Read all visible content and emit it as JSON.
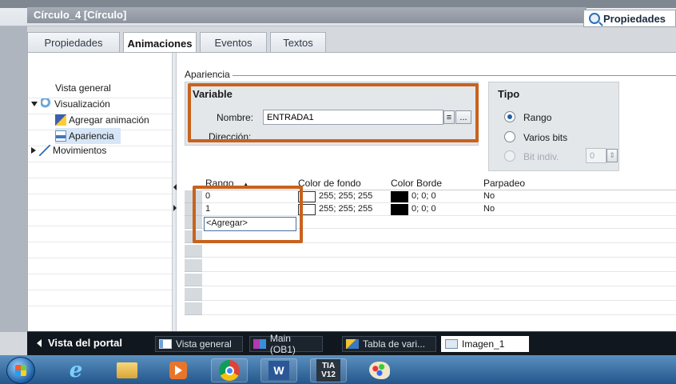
{
  "window": {
    "object_title": "Círculo_4 [Círculo]",
    "properties_button": "Propiedades"
  },
  "tabs": [
    {
      "label": "Propiedades",
      "active": false
    },
    {
      "label": "Animaciones",
      "active": true
    },
    {
      "label": "Eventos",
      "active": false
    },
    {
      "label": "Textos",
      "active": false
    }
  ],
  "tree": {
    "items": [
      {
        "label": "Vista general"
      },
      {
        "label": "Visualización"
      },
      {
        "label": "Agregar animación"
      },
      {
        "label": "Apariencia"
      },
      {
        "label": "Movimientos"
      }
    ]
  },
  "section": {
    "title": "Apariencia"
  },
  "variable": {
    "title": "Variable",
    "name_label": "Nombre:",
    "name_value": "ENTRADA1",
    "browse_label": "...",
    "direction_label": "Dirección:"
  },
  "tipo": {
    "title": "Tipo",
    "options": [
      {
        "label": "Rango",
        "checked": true,
        "enabled": true
      },
      {
        "label": "Varios bits",
        "checked": false,
        "enabled": true
      },
      {
        "label": "Bit indiv.",
        "checked": false,
        "enabled": false
      }
    ],
    "bit_value": "0"
  },
  "table": {
    "headers": [
      "Rango",
      "Color de fondo",
      "Color Borde",
      "Parpadeo"
    ],
    "rows": [
      {
        "rango": "0",
        "bg_color": "255; 255; 255",
        "border_color": "0; 0; 0",
        "blink": "No"
      },
      {
        "rango": "1",
        "bg_color": "255; 255; 255",
        "border_color": "0; 0; 0",
        "blink": "No"
      }
    ],
    "add_label": "<Agregar>"
  },
  "portal": {
    "back_label": "Vista del portal",
    "tabs": [
      {
        "label": "Vista general",
        "active": false
      },
      {
        "label": "Main (OB1)",
        "active": false
      },
      {
        "label": "Tabla de vari...",
        "active": false
      },
      {
        "label": "Imagen_1",
        "active": true
      }
    ]
  },
  "taskbar": {
    "apps": [
      "start-orb",
      "internet-explorer",
      "file-explorer",
      "media-player",
      "chrome",
      "word",
      "tia-portal",
      "paint"
    ],
    "tia_label_top": "TIA",
    "tia_label_bottom": "V12",
    "word_label": "W"
  },
  "colors": {
    "highlight": "#c8621e",
    "panel_bg": "#e4e7ea",
    "portal_bar": "#11171e",
    "taskbar": "#3a6fa6"
  }
}
